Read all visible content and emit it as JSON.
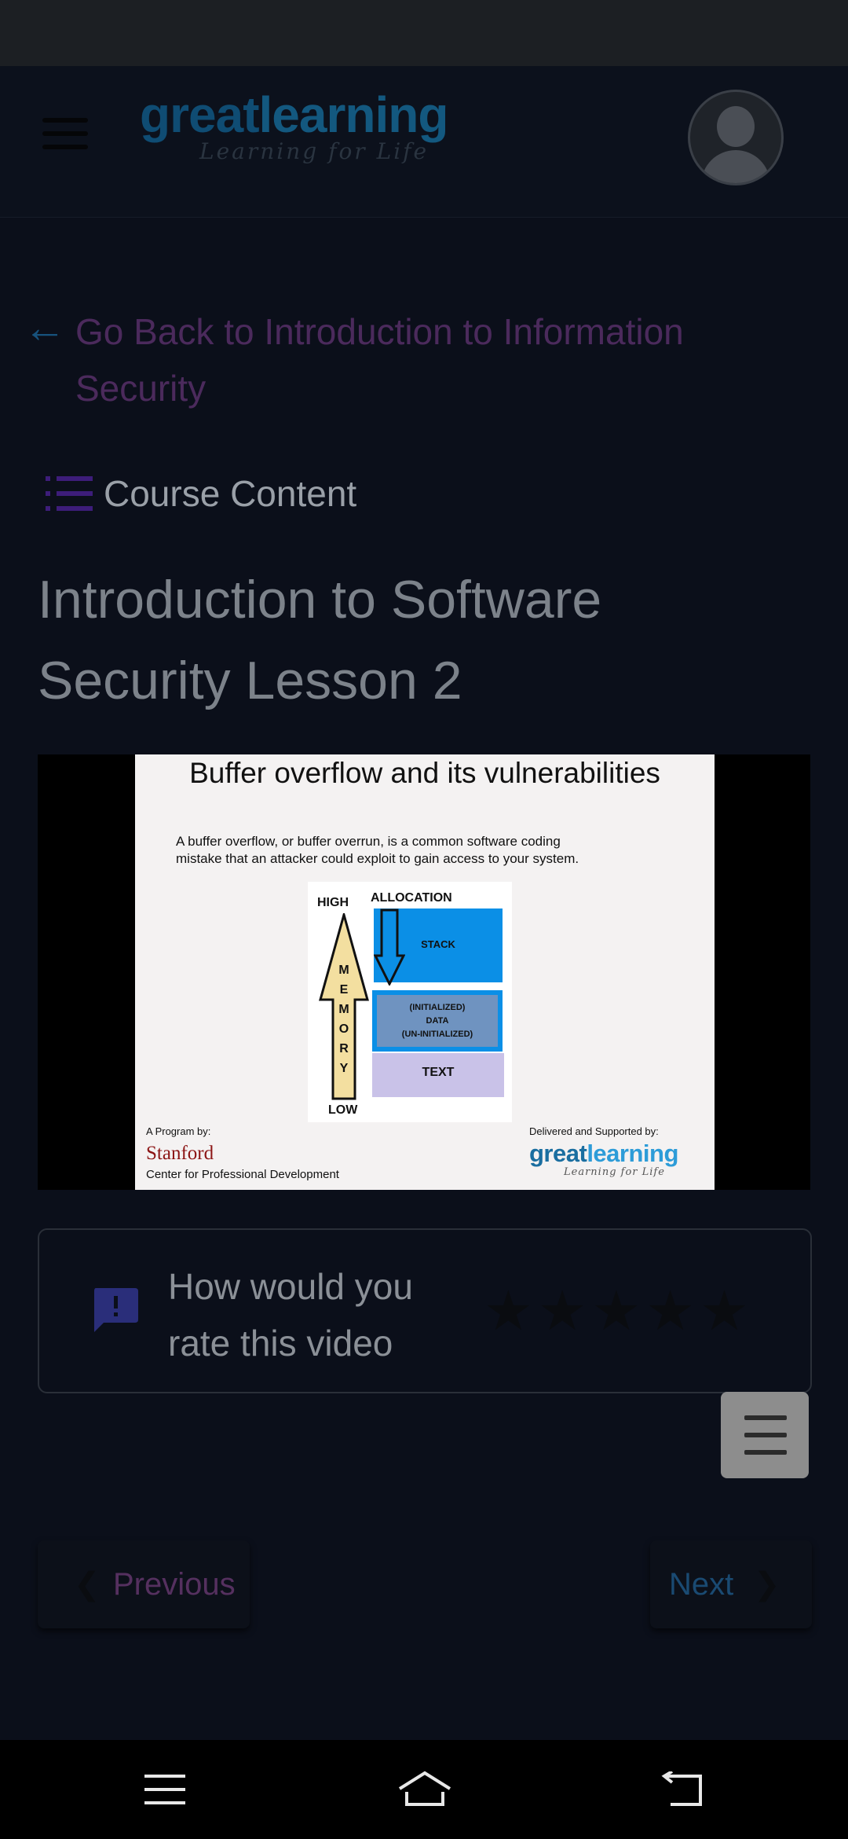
{
  "header": {
    "menu_icon": "hamburger-icon",
    "logo_brand_part1": "great",
    "logo_brand_part2": "learning",
    "logo_tagline": "Learning for Life",
    "avatar_icon": "user-avatar-icon"
  },
  "back_link": {
    "icon": "arrow-left-icon",
    "label": "Go Back to Introduction to Information Security"
  },
  "course_content": {
    "icon": "list-icon",
    "label": "Course Content"
  },
  "lesson": {
    "title": "Introduction to Software Security Lesson 2"
  },
  "video": {
    "slide_title": "Buffer overflow and its vulnerabilities",
    "slide_body": "A buffer overflow, or buffer overrun, is a common software coding mistake that an attacker could exploit to gain access to your system.",
    "diagram": {
      "high": "HIGH",
      "low": "LOW",
      "allocation": "ALLOCATION",
      "memory_letters": [
        "M",
        "E",
        "M",
        "O",
        "R",
        "Y"
      ],
      "stack": "STACK",
      "data_line1": "(INITIALIZED)",
      "data_line2": "DATA",
      "data_line3": "(UN-INITIALIZED)",
      "text": "TEXT"
    },
    "program_by": "A Program by:",
    "stanford": "Stanford",
    "cpd": "Center for Professional Development",
    "delivered_by": "Delivered and Supported by:",
    "gl_part1": "great",
    "gl_part2": "learning",
    "gl_tagline": "Learning for Life"
  },
  "rating": {
    "icon": "feedback-icon",
    "prompt": "How would you rate this video",
    "stars": [
      "★",
      "★",
      "★",
      "★",
      "★"
    ],
    "star_icon": "star-icon"
  },
  "fab": {
    "icon": "menu-icon"
  },
  "pager": {
    "prev_label": "Previous",
    "next_label": "Next",
    "prev_icon": "chevron-left-icon",
    "next_icon": "chevron-right-icon"
  },
  "system_nav": {
    "menu_icon": "recents-icon",
    "home_icon": "home-icon",
    "back_icon": "back-icon"
  }
}
